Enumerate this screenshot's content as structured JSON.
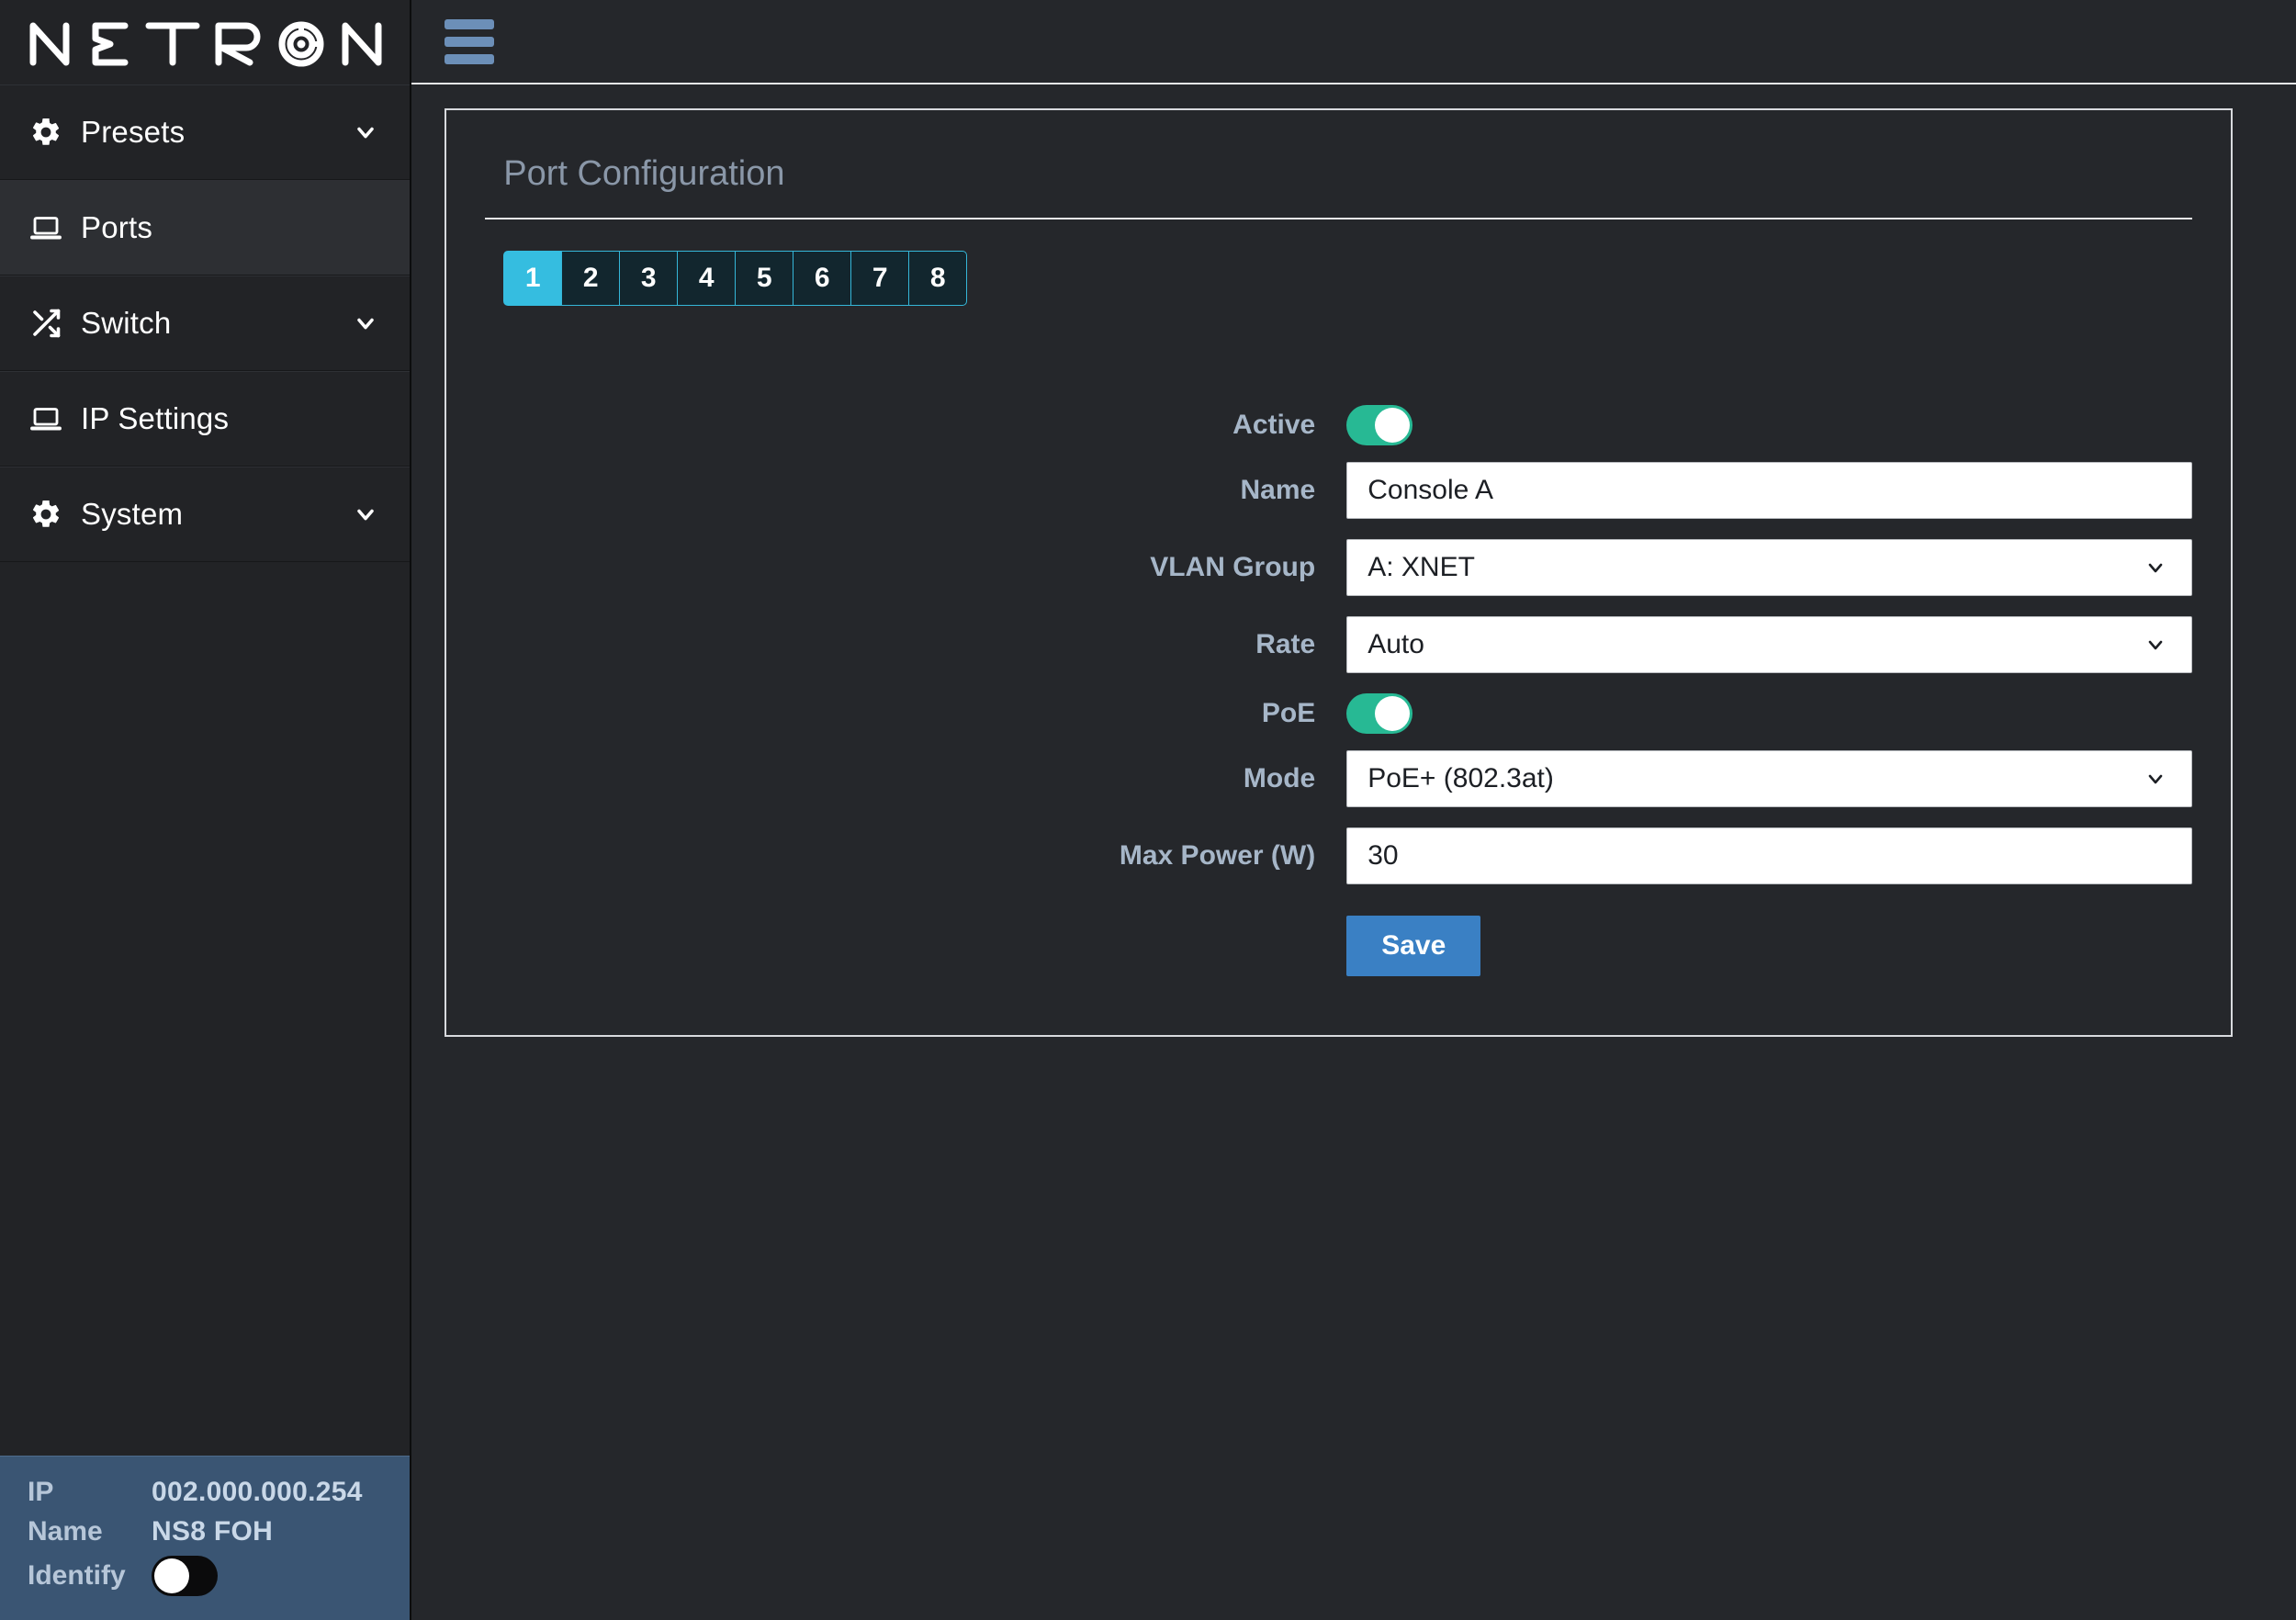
{
  "brand": {
    "name": "NETRON"
  },
  "topbar": {
    "menu_icon": "hamburger-menu-icon"
  },
  "sidebar": {
    "items": [
      {
        "label": "Presets",
        "icon": "gear-icon",
        "has_chevron": true,
        "active": false
      },
      {
        "label": "Ports",
        "icon": "laptop-icon",
        "has_chevron": false,
        "active": true
      },
      {
        "label": "Switch",
        "icon": "shuffle-icon",
        "has_chevron": true,
        "active": false
      },
      {
        "label": "IP Settings",
        "icon": "laptop-icon",
        "has_chevron": false,
        "active": false
      },
      {
        "label": "System",
        "icon": "gear-icon",
        "has_chevron": true,
        "active": false
      }
    ],
    "status": {
      "ip_label": "IP",
      "ip_value": "002.000.000.254",
      "name_label": "Name",
      "name_value": "NS8 FOH",
      "identify_label": "Identify",
      "identify_state": "off"
    }
  },
  "card": {
    "title": "Port Configuration",
    "port_tabs": [
      "1",
      "2",
      "3",
      "4",
      "5",
      "6",
      "7",
      "8"
    ],
    "active_port_tab": "1",
    "fields": {
      "active_label": "Active",
      "active_state": "on",
      "name_label": "Name",
      "name_value": "Console A",
      "vlan_label": "VLAN Group",
      "vlan_value": "A:  XNET",
      "rate_label": "Rate",
      "rate_value": "Auto",
      "poe_label": "PoE",
      "poe_state": "on",
      "mode_label": "Mode",
      "mode_value": "PoE+ (802.3at)",
      "maxpower_label": "Max Power (W)",
      "maxpower_value": "30"
    },
    "save_label": "Save"
  },
  "colors": {
    "accent_cyan": "#35bde0",
    "toggle_green": "#27b994",
    "save_blue": "#3a80c4",
    "status_panel": "#3a5573"
  }
}
